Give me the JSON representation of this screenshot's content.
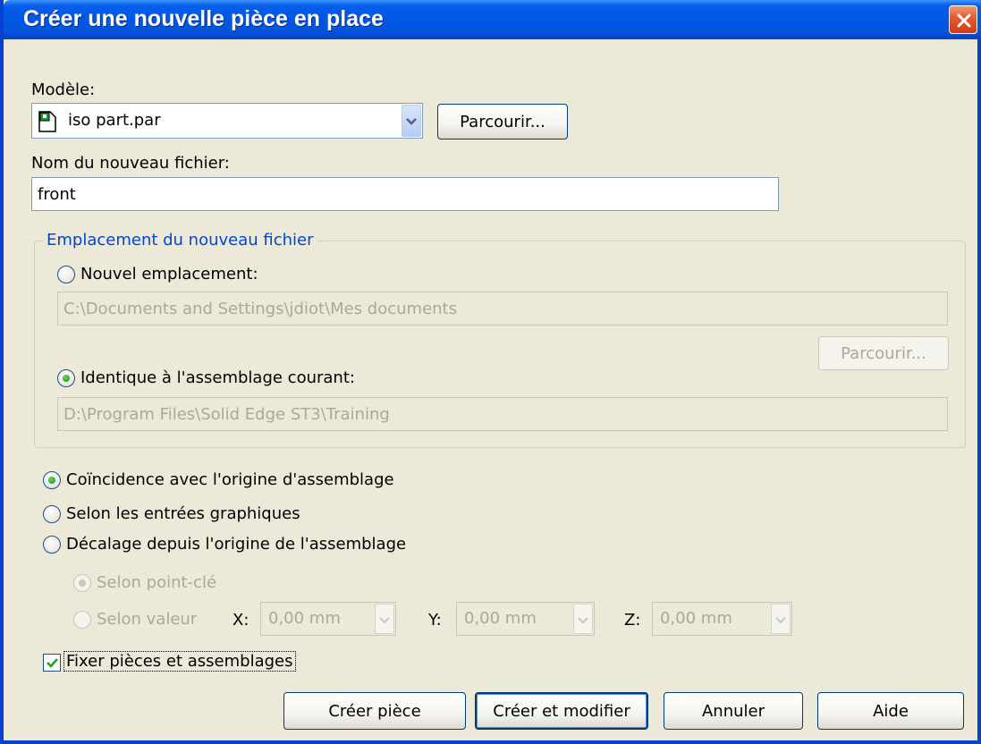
{
  "window": {
    "title": "Créer une nouvelle pièce en place"
  },
  "template": {
    "label": "Modèle:",
    "value": "iso part.par",
    "icon": "part-file-icon",
    "browse_label": "Parcourir..."
  },
  "new_file": {
    "label": "Nom du nouveau fichier:",
    "value": "front"
  },
  "location": {
    "group_title": "Emplacement du nouveau fichier",
    "new_location_label": "Nouvel emplacement:",
    "new_location_selected": false,
    "new_location_path": "C:\\Documents and Settings\\jdiot\\Mes documents",
    "browse_label": "Parcourir...",
    "same_as_assembly_label": "Identique à l'assemblage courant:",
    "same_as_assembly_selected": true,
    "same_as_assembly_path": "D:\\Program Files\\Solid Edge ST3\\Training"
  },
  "placement": {
    "coincident_label": "Coïncidence avec l'origine d'assemblage",
    "coincident_selected": true,
    "graphic_input_label": "Selon les entrées graphiques",
    "offset_label": "Décalage depuis l'origine de l'assemblage",
    "by_keypoint_label": "Selon point-clé",
    "by_value_label": "Selon valeur",
    "x_label": "X:",
    "x_value": "0,00 mm",
    "y_label": "Y:",
    "y_value": "0,00 mm",
    "z_label": "Z:",
    "z_value": "0,00 mm"
  },
  "fix_parts": {
    "label": "Fixer pièces et assemblages",
    "checked": true
  },
  "buttons": {
    "create": "Créer pièce",
    "create_and_edit": "Créer et modifier",
    "cancel": "Annuler",
    "help": "Aide"
  },
  "colors": {
    "titlebar": "#0058e6",
    "dialog_bg": "#ece9d8",
    "group_title": "#0046d5",
    "disabled_text": "#aca899"
  }
}
